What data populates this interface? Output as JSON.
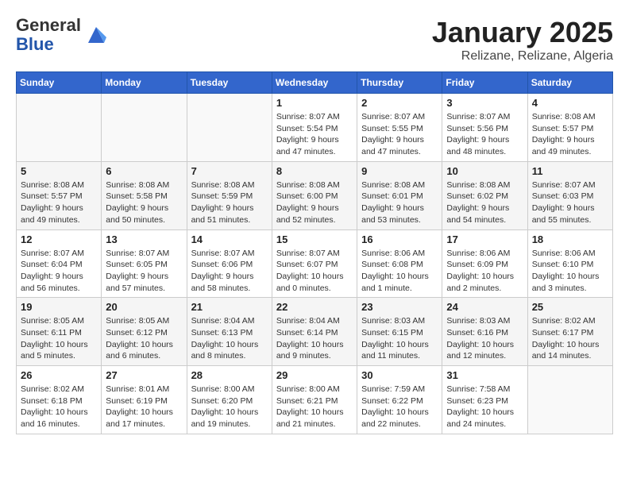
{
  "header": {
    "logo_line1": "General",
    "logo_line2": "Blue",
    "month": "January 2025",
    "location": "Relizane, Relizane, Algeria"
  },
  "days_of_week": [
    "Sunday",
    "Monday",
    "Tuesday",
    "Wednesday",
    "Thursday",
    "Friday",
    "Saturday"
  ],
  "weeks": [
    [
      {
        "day": "",
        "info": ""
      },
      {
        "day": "",
        "info": ""
      },
      {
        "day": "",
        "info": ""
      },
      {
        "day": "1",
        "info": "Sunrise: 8:07 AM\nSunset: 5:54 PM\nDaylight: 9 hours\nand 47 minutes."
      },
      {
        "day": "2",
        "info": "Sunrise: 8:07 AM\nSunset: 5:55 PM\nDaylight: 9 hours\nand 47 minutes."
      },
      {
        "day": "3",
        "info": "Sunrise: 8:07 AM\nSunset: 5:56 PM\nDaylight: 9 hours\nand 48 minutes."
      },
      {
        "day": "4",
        "info": "Sunrise: 8:08 AM\nSunset: 5:57 PM\nDaylight: 9 hours\nand 49 minutes."
      }
    ],
    [
      {
        "day": "5",
        "info": "Sunrise: 8:08 AM\nSunset: 5:57 PM\nDaylight: 9 hours\nand 49 minutes."
      },
      {
        "day": "6",
        "info": "Sunrise: 8:08 AM\nSunset: 5:58 PM\nDaylight: 9 hours\nand 50 minutes."
      },
      {
        "day": "7",
        "info": "Sunrise: 8:08 AM\nSunset: 5:59 PM\nDaylight: 9 hours\nand 51 minutes."
      },
      {
        "day": "8",
        "info": "Sunrise: 8:08 AM\nSunset: 6:00 PM\nDaylight: 9 hours\nand 52 minutes."
      },
      {
        "day": "9",
        "info": "Sunrise: 8:08 AM\nSunset: 6:01 PM\nDaylight: 9 hours\nand 53 minutes."
      },
      {
        "day": "10",
        "info": "Sunrise: 8:08 AM\nSunset: 6:02 PM\nDaylight: 9 hours\nand 54 minutes."
      },
      {
        "day": "11",
        "info": "Sunrise: 8:07 AM\nSunset: 6:03 PM\nDaylight: 9 hours\nand 55 minutes."
      }
    ],
    [
      {
        "day": "12",
        "info": "Sunrise: 8:07 AM\nSunset: 6:04 PM\nDaylight: 9 hours\nand 56 minutes."
      },
      {
        "day": "13",
        "info": "Sunrise: 8:07 AM\nSunset: 6:05 PM\nDaylight: 9 hours\nand 57 minutes."
      },
      {
        "day": "14",
        "info": "Sunrise: 8:07 AM\nSunset: 6:06 PM\nDaylight: 9 hours\nand 58 minutes."
      },
      {
        "day": "15",
        "info": "Sunrise: 8:07 AM\nSunset: 6:07 PM\nDaylight: 10 hours\nand 0 minutes."
      },
      {
        "day": "16",
        "info": "Sunrise: 8:06 AM\nSunset: 6:08 PM\nDaylight: 10 hours\nand 1 minute."
      },
      {
        "day": "17",
        "info": "Sunrise: 8:06 AM\nSunset: 6:09 PM\nDaylight: 10 hours\nand 2 minutes."
      },
      {
        "day": "18",
        "info": "Sunrise: 8:06 AM\nSunset: 6:10 PM\nDaylight: 10 hours\nand 3 minutes."
      }
    ],
    [
      {
        "day": "19",
        "info": "Sunrise: 8:05 AM\nSunset: 6:11 PM\nDaylight: 10 hours\nand 5 minutes."
      },
      {
        "day": "20",
        "info": "Sunrise: 8:05 AM\nSunset: 6:12 PM\nDaylight: 10 hours\nand 6 minutes."
      },
      {
        "day": "21",
        "info": "Sunrise: 8:04 AM\nSunset: 6:13 PM\nDaylight: 10 hours\nand 8 minutes."
      },
      {
        "day": "22",
        "info": "Sunrise: 8:04 AM\nSunset: 6:14 PM\nDaylight: 10 hours\nand 9 minutes."
      },
      {
        "day": "23",
        "info": "Sunrise: 8:03 AM\nSunset: 6:15 PM\nDaylight: 10 hours\nand 11 minutes."
      },
      {
        "day": "24",
        "info": "Sunrise: 8:03 AM\nSunset: 6:16 PM\nDaylight: 10 hours\nand 12 minutes."
      },
      {
        "day": "25",
        "info": "Sunrise: 8:02 AM\nSunset: 6:17 PM\nDaylight: 10 hours\nand 14 minutes."
      }
    ],
    [
      {
        "day": "26",
        "info": "Sunrise: 8:02 AM\nSunset: 6:18 PM\nDaylight: 10 hours\nand 16 minutes."
      },
      {
        "day": "27",
        "info": "Sunrise: 8:01 AM\nSunset: 6:19 PM\nDaylight: 10 hours\nand 17 minutes."
      },
      {
        "day": "28",
        "info": "Sunrise: 8:00 AM\nSunset: 6:20 PM\nDaylight: 10 hours\nand 19 minutes."
      },
      {
        "day": "29",
        "info": "Sunrise: 8:00 AM\nSunset: 6:21 PM\nDaylight: 10 hours\nand 21 minutes."
      },
      {
        "day": "30",
        "info": "Sunrise: 7:59 AM\nSunset: 6:22 PM\nDaylight: 10 hours\nand 22 minutes."
      },
      {
        "day": "31",
        "info": "Sunrise: 7:58 AM\nSunset: 6:23 PM\nDaylight: 10 hours\nand 24 minutes."
      },
      {
        "day": "",
        "info": ""
      }
    ]
  ]
}
